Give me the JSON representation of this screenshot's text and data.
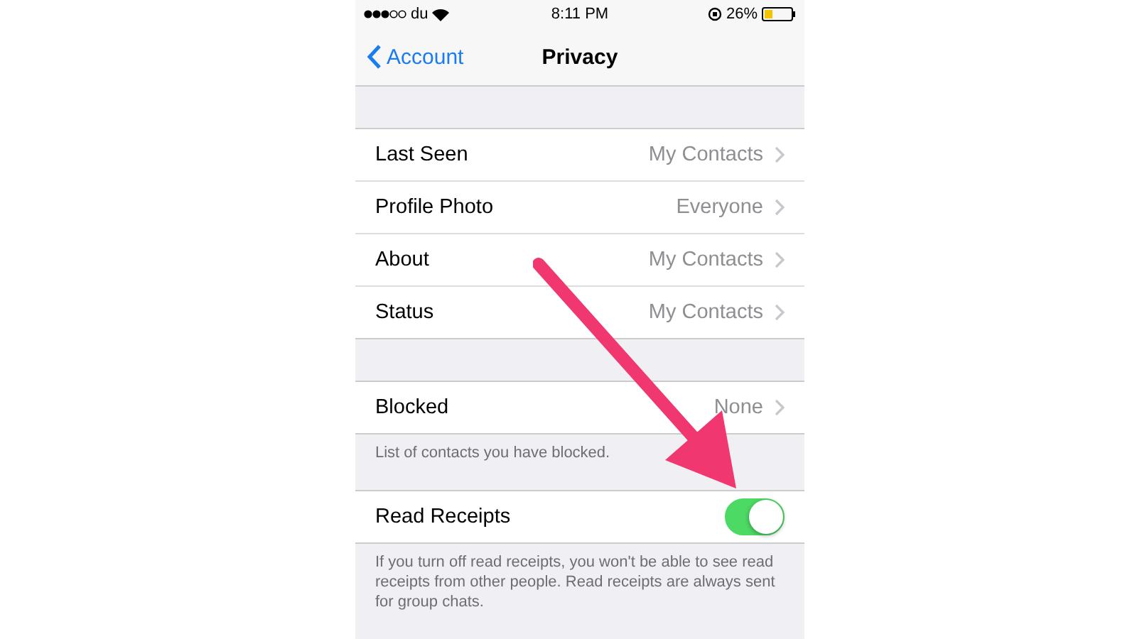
{
  "status_bar": {
    "carrier": "du",
    "time": "8:11 PM",
    "battery": "26%"
  },
  "nav": {
    "back": "Account",
    "title": "Privacy"
  },
  "sections": [
    {
      "rows": [
        {
          "kind": "link",
          "label": "Last Seen",
          "value": "My Contacts"
        },
        {
          "kind": "link",
          "label": "Profile Photo",
          "value": "Everyone"
        },
        {
          "kind": "link",
          "label": "About",
          "value": "My Contacts"
        },
        {
          "kind": "link",
          "label": "Status",
          "value": "My Contacts"
        }
      ]
    },
    {
      "rows": [
        {
          "kind": "link",
          "label": "Blocked",
          "value": "None"
        }
      ],
      "footer": "List of contacts you have blocked."
    },
    {
      "rows": [
        {
          "kind": "switch",
          "label": "Read Receipts",
          "on": true
        }
      ],
      "footer": "If you turn off read receipts, you won't be able to see read receipts from other people. Read receipts are always sent for group chats."
    }
  ],
  "annotation": {
    "kind": "arrow"
  }
}
